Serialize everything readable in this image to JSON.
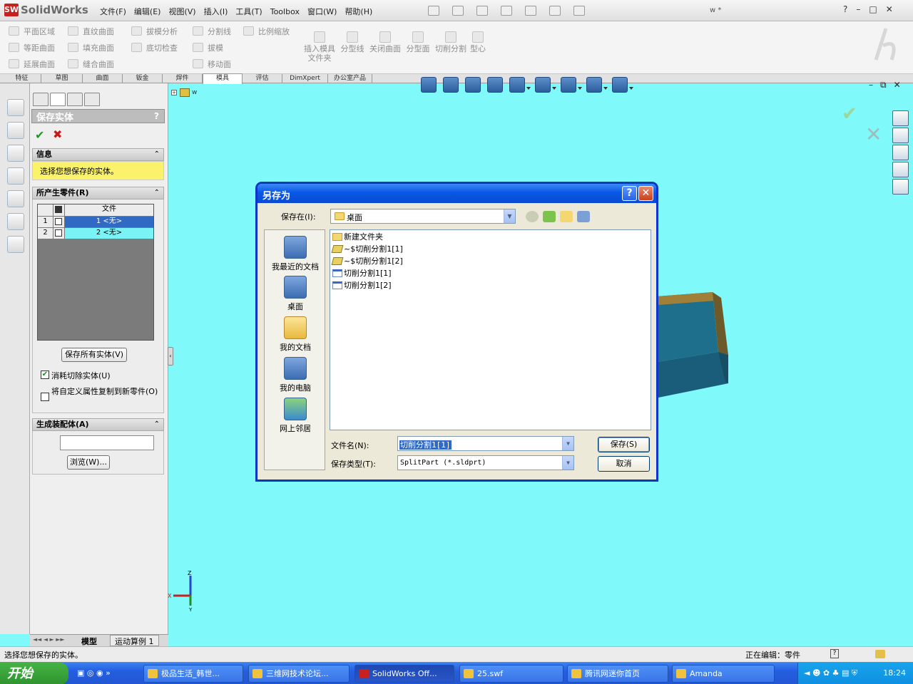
{
  "app": {
    "brand": "SolidWorks",
    "doc_title": "w *",
    "menus": [
      "文件(F)",
      "编辑(E)",
      "视图(V)",
      "插入(I)",
      "工具(T)",
      "Toolbox",
      "窗口(W)",
      "帮助(H)"
    ],
    "window_controls": [
      "?",
      "–",
      "□",
      "✕"
    ]
  },
  "commands": {
    "col1": [
      "平面区域",
      "等距曲面",
      "延展曲面"
    ],
    "col2": [
      "直纹曲面",
      "填充曲面",
      "缝合曲面"
    ],
    "col3": [
      "拔模分析",
      "底切检查"
    ],
    "col4": [
      "分割线",
      "拔模",
      "移动面"
    ],
    "col5": [
      "比例缩放"
    ],
    "big": [
      "插入模具文件夹",
      "分型线",
      "关闭曲面",
      "分型面",
      "切削分割",
      "型心"
    ]
  },
  "tabs": [
    "特征",
    "草图",
    "曲面",
    "钣金",
    "焊件",
    "模具",
    "评估",
    "DimXpert",
    "办公室产品"
  ],
  "active_tab": "模具",
  "property_manager": {
    "title": "保存实体",
    "help": "?",
    "info_header": "信息",
    "info_text": "选择您想保存的实体。",
    "parts_header": "所产生零件(R)",
    "grid_col": "文件",
    "rows": [
      {
        "num": "1",
        "value": "1 <无>"
      },
      {
        "num": "2",
        "value": "2 <无>"
      }
    ],
    "save_all_button": "保存所有实体(V)",
    "consume_cut": "消耗切除实体(U)",
    "consume_cut_checked": true,
    "copy_props": "将自定义属性复制到新零件(O)",
    "copy_props_checked": false,
    "assembly_header": "生成装配体(A)",
    "browse_button": "浏览(W)..."
  },
  "model_tabs": [
    "模型",
    "运动算例 1"
  ],
  "status": {
    "left": "选择您想保存的实体。",
    "editing": "正在编辑：零件"
  },
  "viewport": {
    "tree_node": "w",
    "axis_z": "Z",
    "axis_x": "X",
    "axis_y": "Y",
    "background": "#7ff9f9"
  },
  "dialog": {
    "title": "另存为",
    "save_in_label": "保存在(I):",
    "save_in_value": "桌面",
    "places": [
      "我最近的文档",
      "桌面",
      "我的文档",
      "我的电脑",
      "网上邻居"
    ],
    "files": [
      {
        "name": "新建文件夹",
        "type": "folder"
      },
      {
        "name": "~$切削分割1[1]",
        "type": "temp"
      },
      {
        "name": "~$切削分割1[2]",
        "type": "temp"
      },
      {
        "name": "切削分割1[1]",
        "type": "part"
      },
      {
        "name": "切削分割1[2]",
        "type": "part"
      }
    ],
    "filename_label": "文件名(N):",
    "filename_value": "切削分割1[1]",
    "filetype_label": "保存类型(T):",
    "filetype_value": "SplitPart (*.sldprt)",
    "save_button": "保存(S)",
    "cancel_button": "取消"
  },
  "taskbar": {
    "start": "开始",
    "tasks": [
      "极品生活_韩世...",
      "三维网技术论坛...",
      "SolidWorks Off...",
      "25.swf",
      "腾讯网迷你首页",
      "Amanda"
    ],
    "clock": "18:24"
  }
}
